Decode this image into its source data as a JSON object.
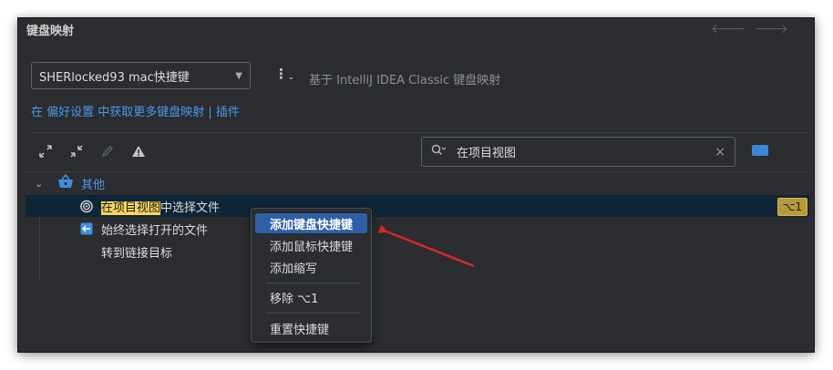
{
  "panel": {
    "title": "键盘映射",
    "nav_back": "🡐",
    "nav_forward": "🡒"
  },
  "keymap": {
    "selected": "SHERlocked93 mac快捷键",
    "based_on": "基于 IntelliJ IDEA Classic 键盘映射",
    "more_label": "⋮"
  },
  "links": {
    "prefix": "在 偏好设置 中获取更多键盘映射",
    "separator": " | ",
    "plugins": "插件"
  },
  "toolbar": {
    "expand_icon": "expand-all-icon",
    "collapse_icon": "collapse-all-icon",
    "edit_icon": "edit-icon",
    "conflicts_icon": "warning-icon"
  },
  "search": {
    "value": "在项目视图",
    "clear": "×"
  },
  "tree": {
    "category": "其他",
    "items": [
      {
        "highlight": "在项目视图",
        "rest": "中选择文件",
        "shortcut": "⌥1",
        "selected": true
      },
      {
        "highlight": "",
        "rest": "始终选择打开的文件",
        "shortcut": "",
        "selected": false
      },
      {
        "highlight": "",
        "rest": "转到链接目标",
        "shortcut": "",
        "selected": false
      }
    ]
  },
  "context_menu": {
    "items": [
      "添加键盘快捷键",
      "添加鼠标快捷键",
      "添加缩写",
      "移除 ⌥1",
      "重置快捷键"
    ]
  },
  "colors": {
    "panel_bg": "#2b2d30",
    "accent": "#4f95e8",
    "highlight": "#f7d55c",
    "menu_active": "#2e5fa8",
    "annotation_arrow": "#d7262b"
  }
}
